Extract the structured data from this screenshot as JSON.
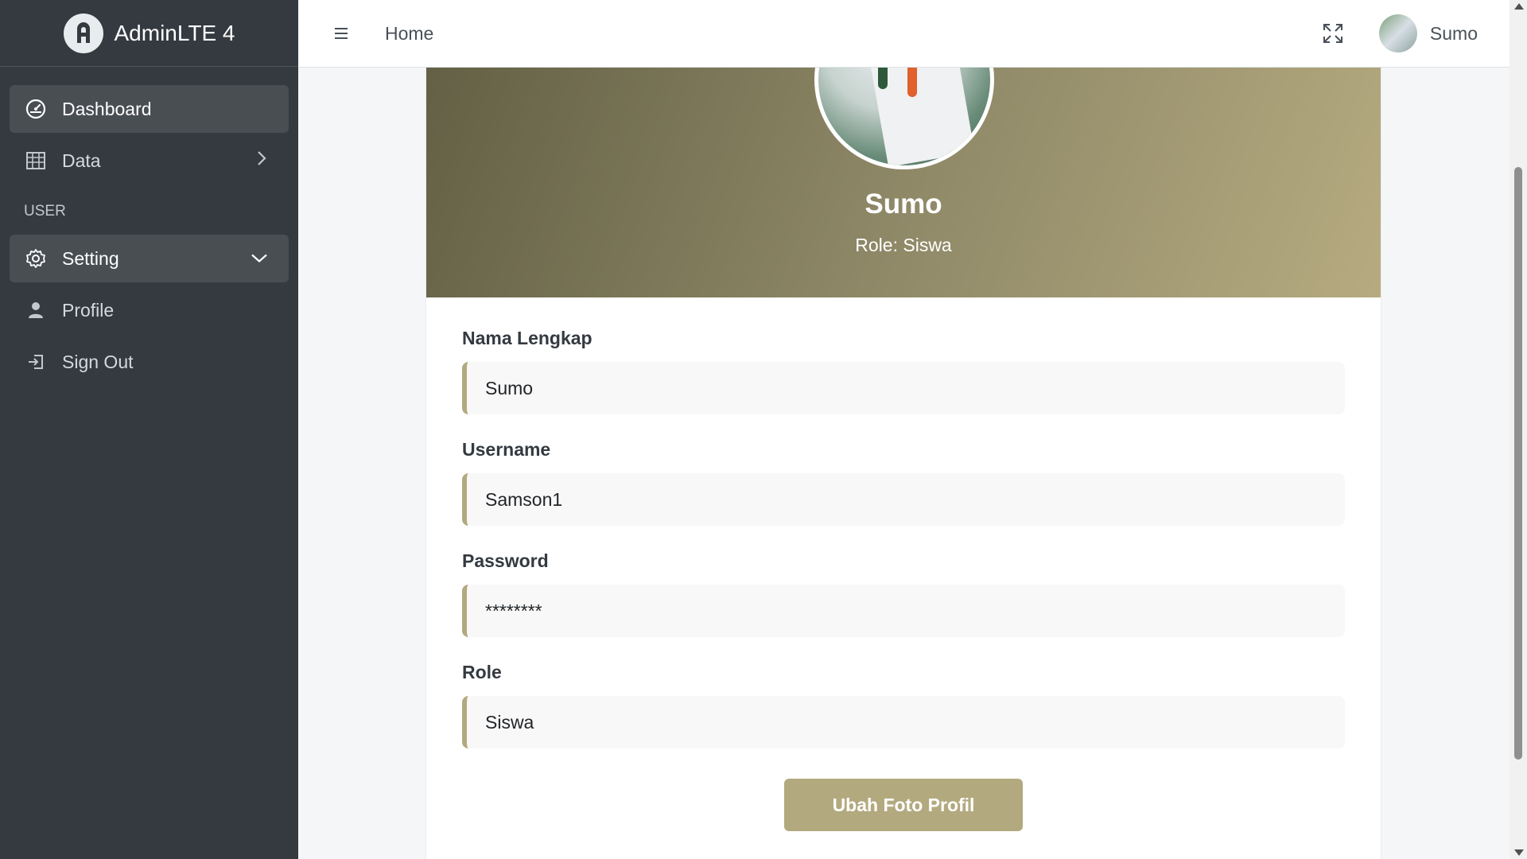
{
  "brand": {
    "name": "AdminLTE 4"
  },
  "sidebar": {
    "items": [
      {
        "label": "Dashboard",
        "icon": "dashboard-icon",
        "active": true
      },
      {
        "label": "Data",
        "icon": "table-icon"
      }
    ],
    "section_header": "USER",
    "user_items": [
      {
        "label": "Setting",
        "icon": "gear-icon",
        "active": true,
        "expanded": true
      },
      {
        "label": "Profile",
        "icon": "person-icon"
      },
      {
        "label": "Sign Out",
        "icon": "sign-out-icon"
      }
    ]
  },
  "topbar": {
    "menu_icon": "hamburger-icon",
    "home_label": "Home",
    "fullscreen_icon": "fullscreen-icon",
    "user_name": "Sumo"
  },
  "profile": {
    "name": "Sumo",
    "role_text": "Role: Siswa"
  },
  "form": {
    "fields": [
      {
        "label": "Nama Lengkap",
        "value": "Sumo"
      },
      {
        "label": "Username",
        "value": "Samson1"
      },
      {
        "label": "Password",
        "value": "********"
      },
      {
        "label": "Role",
        "value": "Siswa"
      }
    ],
    "button_label": "Ubah Foto Profil"
  },
  "colors": {
    "sidebar_bg": "#343a40",
    "accent": "#b3a97f",
    "header_gradient_start": "#646045",
    "header_gradient_end": "#b6ab80"
  }
}
